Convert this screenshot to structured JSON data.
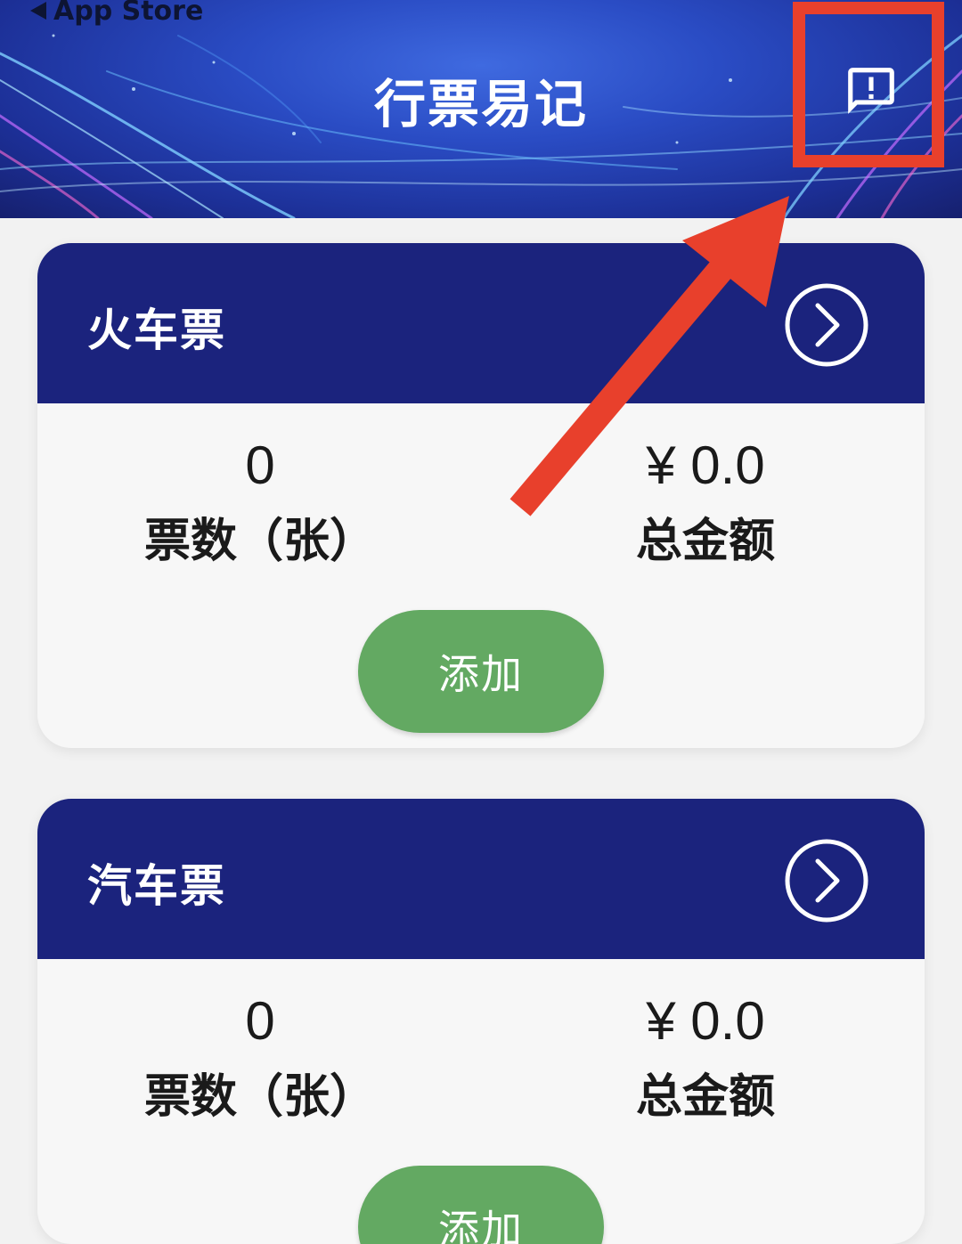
{
  "status_bar": {
    "back_label": "App Store"
  },
  "header": {
    "title": "行票易记",
    "feedback_icon": "feedback-icon"
  },
  "colors": {
    "header_bg": "#2a4cc4",
    "card_header": "#1b237d",
    "add_button": "#63a962",
    "annotation": "#e8402c"
  },
  "cards": [
    {
      "title": "火车票",
      "count_value": "0",
      "count_label": "票数（张）",
      "amount_value": "¥ 0.0",
      "amount_label": "总金额",
      "add_label": "添加"
    },
    {
      "title": "汽车票",
      "count_value": "0",
      "count_label": "票数（张）",
      "amount_value": "¥ 0.0",
      "amount_label": "总金额",
      "add_label": "添加"
    }
  ]
}
